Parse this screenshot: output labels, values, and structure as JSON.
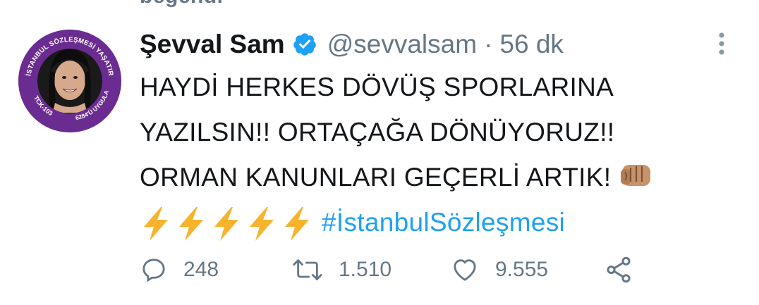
{
  "context": {
    "text": "beğendi"
  },
  "avatar": {
    "ring_text_top": "İSTANBUL SÖZLEŞMESİ YAŞATIR",
    "ring_text_bottom_left": "TCK-103",
    "ring_text_bottom_right": "6284'Ü UYGULA",
    "ring_color": "#6b2c91"
  },
  "tweet": {
    "display_name": "Şevval Sam",
    "verified_icon": "verified-badge-icon",
    "handle": "@sevvalsam",
    "separator": "·",
    "time": "56 dk",
    "lines": [
      "HAYDİ HERKES DÖVÜŞ SPORLARINA",
      "YAZILSIN!! ORTAÇAĞA DÖNÜYORUZ!!",
      "ORMAN KANUNLARI GEÇERLİ ARTIK!"
    ],
    "fist_emoji": "👊",
    "bolt_emoji": "⚡",
    "bolt_count": 5,
    "hashtag": "#İstanbulSözleşmesi"
  },
  "actions": {
    "reply_count": "248",
    "retweet_count": "1.510",
    "like_count": "9.555"
  },
  "colors": {
    "link": "#1da1f2",
    "muted": "#657786",
    "text": "#14171a",
    "verified": "#1da1f2",
    "bolt": "#f7b32b"
  }
}
